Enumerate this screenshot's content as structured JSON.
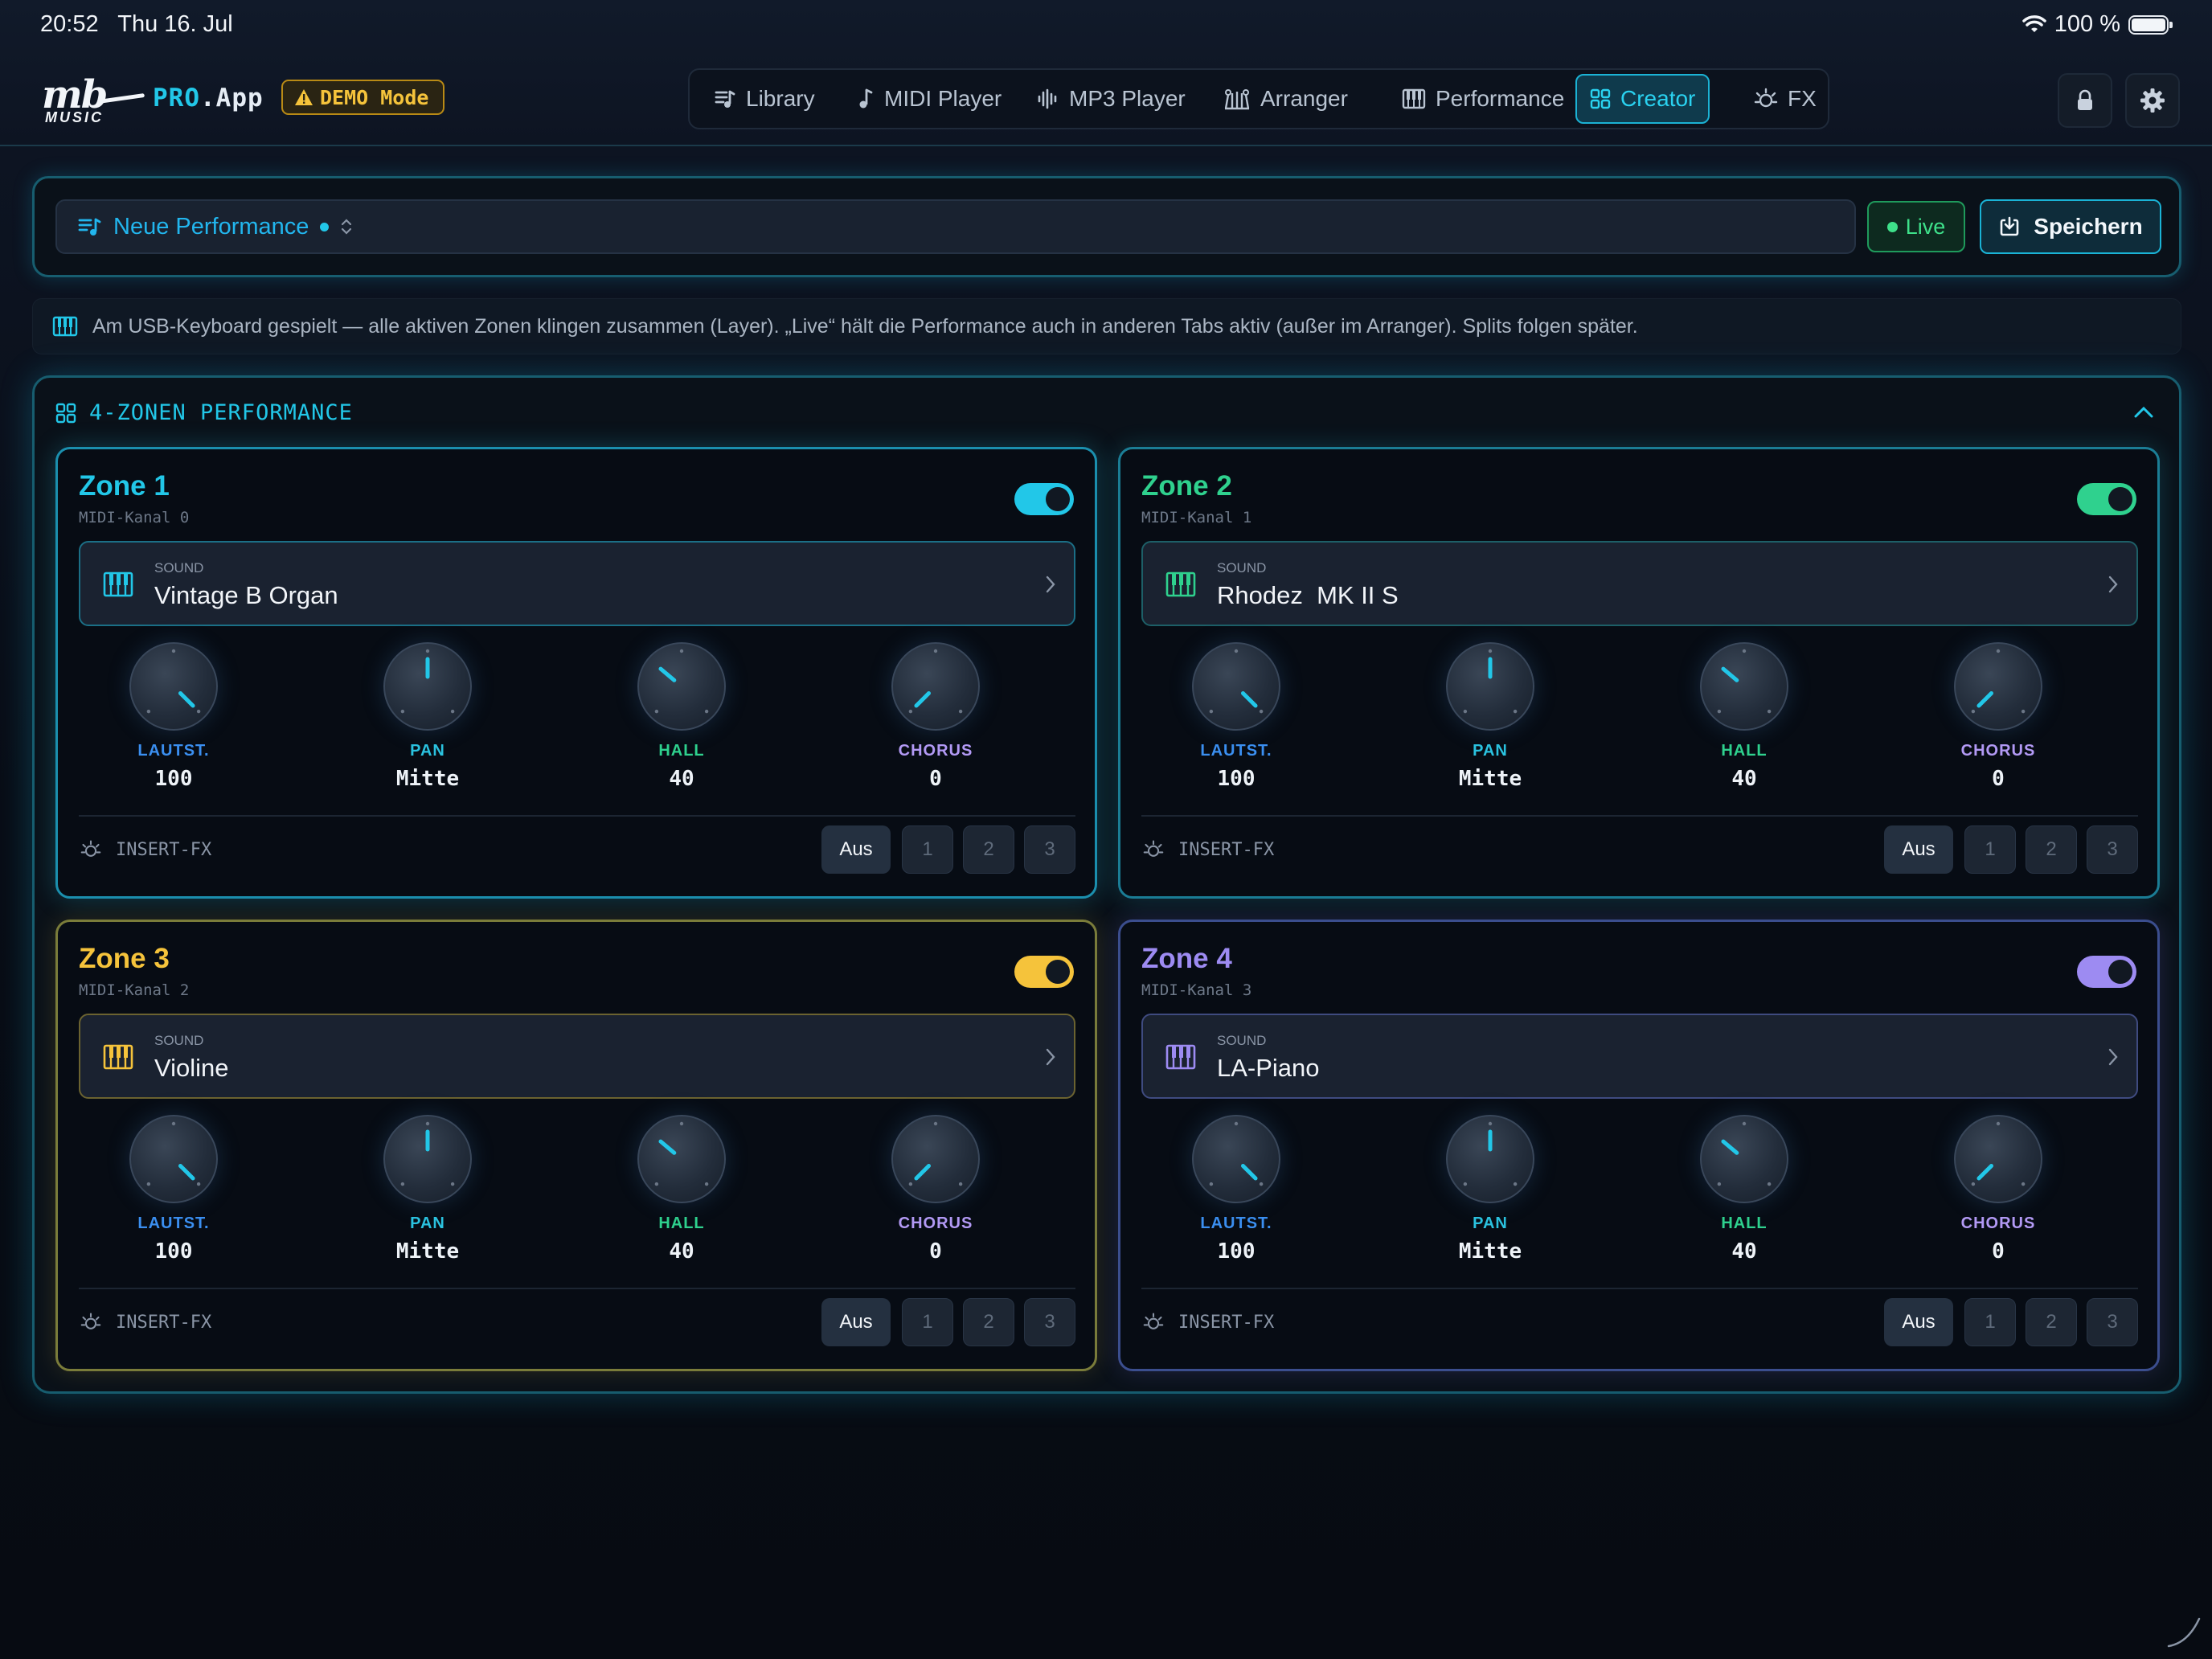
{
  "status_bar": {
    "time": "20:52",
    "date": "Thu 16. Jul",
    "battery": "100 %"
  },
  "header": {
    "logo_text": "mb",
    "logo_sub": "MUSIC",
    "app_name_pro": "PRO",
    "app_name_rest": ".App",
    "demo_badge": "DEMO Mode",
    "tabs": [
      {
        "label": "Library",
        "icon": "library-icon"
      },
      {
        "label": "MIDI Player",
        "icon": "music-note-icon"
      },
      {
        "label": "MP3 Player",
        "icon": "waveform-icon"
      },
      {
        "label": "Arranger",
        "icon": "arranger-icon"
      },
      {
        "label": "Performance",
        "icon": "piano-icon"
      },
      {
        "label": "Creator",
        "icon": "grid-icon",
        "active": true
      },
      {
        "label": "FX",
        "icon": "fx-icon"
      }
    ]
  },
  "performance_bar": {
    "name": "Neue Performance",
    "live_label": "Live",
    "save_label": "Speichern"
  },
  "info_text": "Am USB-Keyboard gespielt — alle aktiven Zonen klingen zusammen (Layer). „Live“ hält die Performance auch in anderen Tabs aktiv (außer im Arranger). Splits folgen später.",
  "panel": {
    "title": "4-ZONEN PERFORMANCE"
  },
  "colors": {
    "zone1": "#22c7e8",
    "zone2": "#2fd18e",
    "zone3": "#f5c33b",
    "zone4": "#9d8bf2",
    "label_lautst": "#3b8ff0",
    "label_pan": "#2bc3e0",
    "label_hall": "#2fd18e",
    "label_chorus": "#b39af5"
  },
  "zones": [
    {
      "name": "Zone 1",
      "channel": "MIDI-Kanal 0",
      "enabled": true,
      "sound_label": "SOUND",
      "sound": "Vintage B Organ",
      "knobs": [
        {
          "label": "LAUTST.",
          "value": "100",
          "level": 1.0
        },
        {
          "label": "PAN",
          "value": "Mitte",
          "level": 0.5
        },
        {
          "label": "HALL",
          "value": "40",
          "level": 0.315
        },
        {
          "label": "CHORUS",
          "value": "0",
          "level": 0.0
        }
      ],
      "insert_fx_label": "INSERT-FX",
      "fx_buttons": [
        "Aus",
        "1",
        "2",
        "3"
      ]
    },
    {
      "name": "Zone 2",
      "channel": "MIDI-Kanal 1",
      "enabled": true,
      "sound_label": "SOUND",
      "sound": "Rhodez  MK II S",
      "knobs": [
        {
          "label": "LAUTST.",
          "value": "100",
          "level": 1.0
        },
        {
          "label": "PAN",
          "value": "Mitte",
          "level": 0.5
        },
        {
          "label": "HALL",
          "value": "40",
          "level": 0.315
        },
        {
          "label": "CHORUS",
          "value": "0",
          "level": 0.0
        }
      ],
      "insert_fx_label": "INSERT-FX",
      "fx_buttons": [
        "Aus",
        "1",
        "2",
        "3"
      ]
    },
    {
      "name": "Zone 3",
      "channel": "MIDI-Kanal 2",
      "enabled": true,
      "sound_label": "SOUND",
      "sound": "Violine",
      "knobs": [
        {
          "label": "LAUTST.",
          "value": "100",
          "level": 1.0
        },
        {
          "label": "PAN",
          "value": "Mitte",
          "level": 0.5
        },
        {
          "label": "HALL",
          "value": "40",
          "level": 0.315
        },
        {
          "label": "CHORUS",
          "value": "0",
          "level": 0.0
        }
      ],
      "insert_fx_label": "INSERT-FX",
      "fx_buttons": [
        "Aus",
        "1",
        "2",
        "3"
      ]
    },
    {
      "name": "Zone 4",
      "channel": "MIDI-Kanal 3",
      "enabled": true,
      "sound_label": "SOUND",
      "sound": "LA-Piano",
      "knobs": [
        {
          "label": "LAUTST.",
          "value": "100",
          "level": 1.0
        },
        {
          "label": "PAN",
          "value": "Mitte",
          "level": 0.5
        },
        {
          "label": "HALL",
          "value": "40",
          "level": 0.315
        },
        {
          "label": "CHORUS",
          "value": "0",
          "level": 0.0
        }
      ],
      "insert_fx_label": "INSERT-FX",
      "fx_buttons": [
        "Aus",
        "1",
        "2",
        "3"
      ]
    }
  ]
}
